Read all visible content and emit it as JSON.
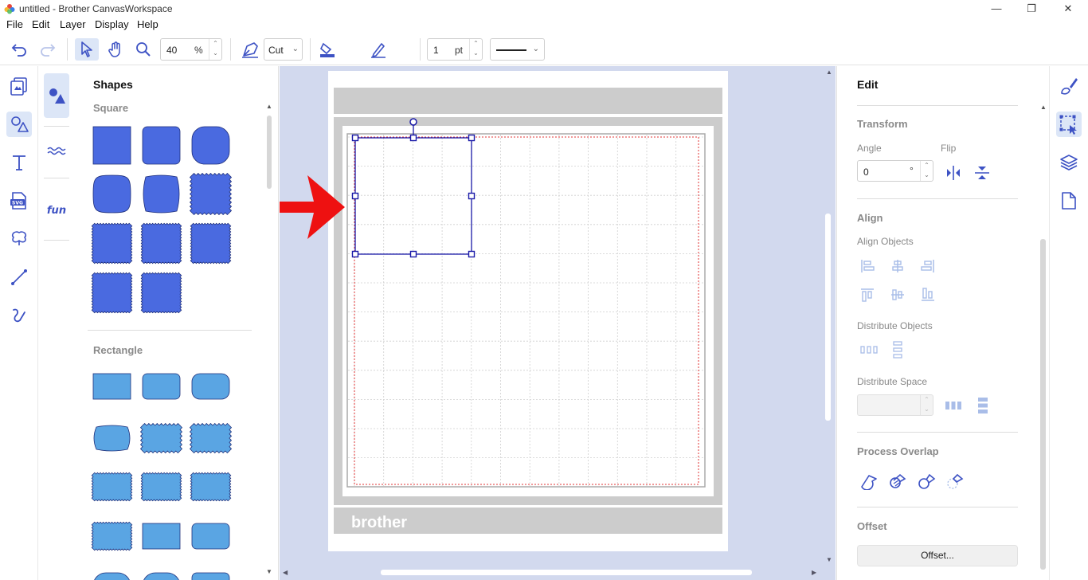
{
  "window": {
    "title": "untitled - Brother CanvasWorkspace",
    "minimize": "—",
    "restore": "❐",
    "close": "✕"
  },
  "menu": [
    "File",
    "Edit",
    "Layer",
    "Display",
    "Help"
  ],
  "toolbar": {
    "zoom_value": "40",
    "zoom_unit": "%",
    "mode_label": "Cut",
    "line_width_value": "1",
    "line_width_unit": "pt",
    "line_color": "#000000"
  },
  "shapes_panel": {
    "title": "Shapes",
    "sections": [
      {
        "title": "Square",
        "fill": "#4a6ae0"
      },
      {
        "title": "Rectangle",
        "fill": "#5aa5e3"
      }
    ]
  },
  "canvas": {
    "brand_text": "brother",
    "background": "#d2d9ee"
  },
  "edit_panel": {
    "title": "Edit",
    "transform": {
      "title": "Transform",
      "angle_label": "Angle",
      "angle_value": "0",
      "angle_unit": "°",
      "flip_label": "Flip"
    },
    "align": {
      "title": "Align",
      "align_objects_label": "Align Objects",
      "distribute_objects_label": "Distribute Objects",
      "distribute_space_label": "Distribute Space",
      "distribute_space_value": ""
    },
    "process_overlap": {
      "title": "Process Overlap"
    },
    "offset": {
      "title": "Offset",
      "button_label": "Offset..."
    }
  },
  "colors": {
    "accent": "#3d52c4",
    "icon_disabled": "#a9bde8",
    "selection": "#1a1aa8",
    "annotation_arrow": "#ee1111"
  }
}
